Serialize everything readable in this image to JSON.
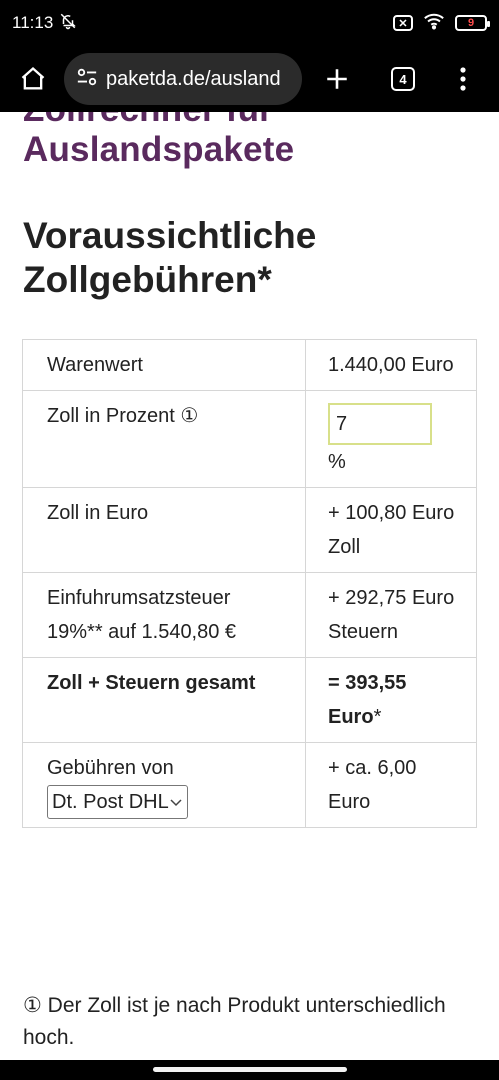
{
  "status": {
    "time": "11:13",
    "battery": "9"
  },
  "browser": {
    "url": "paketda.de/ausland",
    "tab_count": "4"
  },
  "page": {
    "heading": "Zollrechner für Auslandspakete",
    "subheading": "Voraussichtliche Zollgebühren*"
  },
  "table": {
    "warenwert_label": "Warenwert",
    "warenwert_value": "1.440,00 Euro",
    "zoll_prozent_label": "Zoll in Prozent ①",
    "zoll_prozent_input": "7",
    "zoll_prozent_unit": "%",
    "zoll_euro_label": "Zoll in Euro",
    "zoll_euro_value": "+ 100,80 Euro Zoll",
    "eust_label": "Einfuhrumsatzsteuer 19%** auf 1.540,80 €",
    "eust_value": "+ 292,75 Euro Steuern",
    "gesamt_label": "Zoll + Steuern gesamt",
    "gesamt_value": "= 393,55 Euro",
    "gesamt_suffix": "*",
    "gebuehren_label": "Gebühren von",
    "gebuehren_select": "Dt. Post DHL",
    "gebuehren_value": "+ ca. 6,00 Euro"
  },
  "footnote": "① Der Zoll ist je nach Produkt unterschiedlich hoch."
}
